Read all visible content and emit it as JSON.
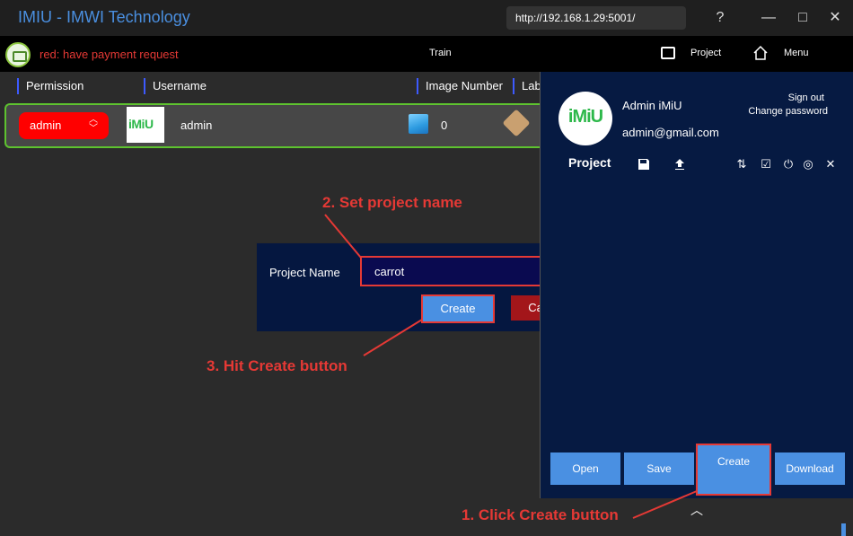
{
  "app": {
    "title": "IMIU - IMWI Technology",
    "url": "http://192.168.1.29:5001/"
  },
  "window": {
    "help": "?",
    "minimize": "—",
    "maximize": "□",
    "close": "✕"
  },
  "toolbar": {
    "payment_notice": "red: have payment request",
    "train_label": "Train",
    "project_label": "Project",
    "menu_label": "Menu"
  },
  "table": {
    "headers": [
      "Permission",
      "Username",
      "Image Number",
      "Lab"
    ],
    "row": {
      "permission": "admin",
      "avatar_text": "iMiU",
      "username": "admin",
      "image_number": "0"
    }
  },
  "dialog": {
    "label": "Project Name",
    "value": "carrot",
    "create_label": "Create",
    "cancel_label": "Cancel"
  },
  "panel": {
    "logo_text": "iMiU",
    "name": "Admin iMiU",
    "email": "admin@gmail.com",
    "sign_out": "Sign out",
    "change_password": "Change password",
    "title": "Project",
    "buttons": {
      "open": "Open",
      "save": "Save",
      "create": "Create",
      "download": "Download"
    }
  },
  "annotations": {
    "step1": "1. Click Create button",
    "step2": "2. Set project name",
    "step3": "3. Hit Create button"
  },
  "colors": {
    "accent": "#4a90e2",
    "annotation": "#e53935",
    "panel_bg": "#061a42",
    "success": "#5ec32f"
  }
}
